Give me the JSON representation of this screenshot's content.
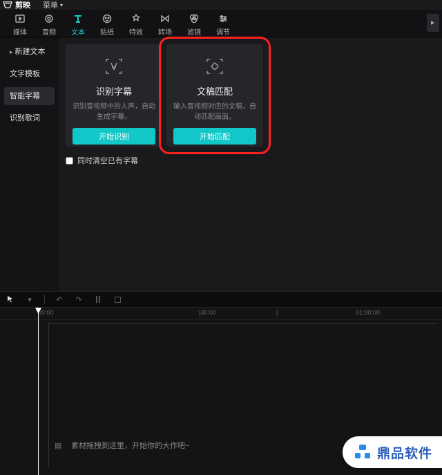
{
  "titlebar": {
    "app_name": "剪映",
    "menu_label": "菜单"
  },
  "toolbar": {
    "items": [
      {
        "label": "媒体",
        "icon": "media"
      },
      {
        "label": "音频",
        "icon": "audio"
      },
      {
        "label": "文本",
        "icon": "text",
        "active": true
      },
      {
        "label": "贴纸",
        "icon": "sticker"
      },
      {
        "label": "特效",
        "icon": "effect"
      },
      {
        "label": "转场",
        "icon": "transition"
      },
      {
        "label": "滤镜",
        "icon": "filter"
      },
      {
        "label": "调节",
        "icon": "adjust"
      }
    ]
  },
  "sidebar": {
    "items": [
      {
        "label": "新建文本",
        "expandable": true
      },
      {
        "label": "文字模板"
      },
      {
        "label": "智能字幕",
        "active": true
      },
      {
        "label": "识别歌词"
      }
    ]
  },
  "cards": [
    {
      "title": "识别字幕",
      "desc": "识别音视频中的人声，自动生成字幕。",
      "button": "开始识别",
      "icon": "recognize"
    },
    {
      "title": "文稿匹配",
      "desc": "输入音视频对应的文稿，自动匹配画面。",
      "button": "开始匹配",
      "icon": "match",
      "highlight": true
    }
  ],
  "checkbox": {
    "label": "同时清空已有字幕"
  },
  "timeline": {
    "ticks": [
      "00:00",
      "|30:00",
      "|",
      "01:00:00"
    ],
    "hint": "素材拖拽到这里，开始你的大作吧~"
  },
  "watermark": {
    "text": "鼎品软件"
  }
}
